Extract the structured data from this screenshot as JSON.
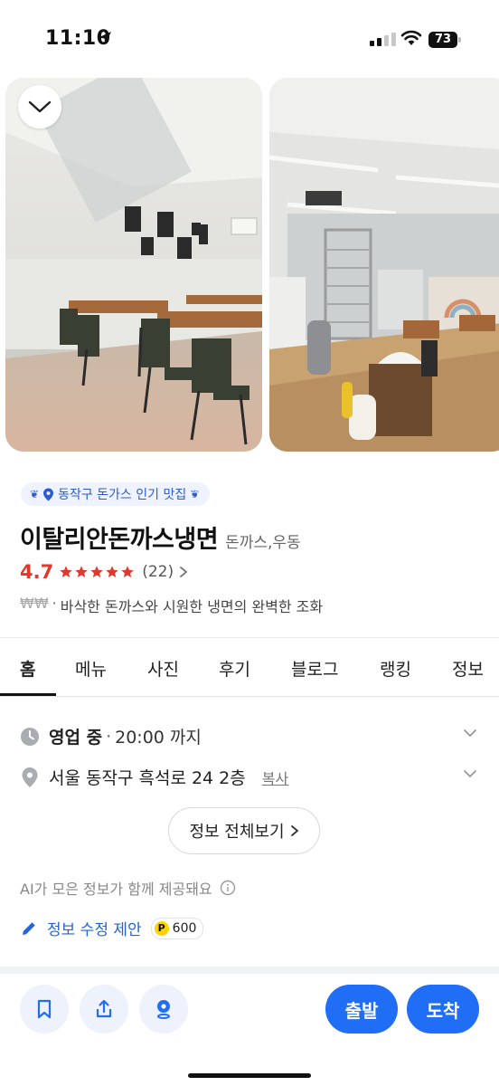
{
  "status_bar": {
    "time": "11:10",
    "battery": "73"
  },
  "place": {
    "badge": "동작구 돈가스 인기 맛집",
    "name": "이탈리안돈까스냉면",
    "category": "돈까스,우동",
    "rating": "4.7",
    "stars_filled": 5,
    "review_count": "(22)",
    "price_level": "₩₩",
    "separator": "·",
    "description": "바삭한 돈까스와 시원한 냉면의 완벽한 조화"
  },
  "tabs": [
    {
      "label": "홈",
      "active": true
    },
    {
      "label": "메뉴"
    },
    {
      "label": "사진"
    },
    {
      "label": "후기"
    },
    {
      "label": "블로그"
    },
    {
      "label": "랭킹"
    },
    {
      "label": "정보"
    }
  ],
  "hours": {
    "status": "영업 중",
    "separator": "·",
    "close_time": "20:00 까지"
  },
  "address": {
    "text": "서울 동작구 흑석로 24 2층",
    "copy_label": "복사"
  },
  "full_info_button": "정보 전체보기",
  "ai_note": "AI가 모은 정보가 함께 제공돼요",
  "edit": {
    "label": "정보 수정 제안",
    "points": "600",
    "coin": "P"
  },
  "bottom": {
    "depart_label": "출발",
    "arrive_label": "도착"
  },
  "colors": {
    "accent": "#1f6ef5",
    "rating": "#e2382b",
    "badge_bg": "#eef3ff"
  },
  "icons": [
    "location-arrow-icon",
    "chevron-down-icon",
    "pin-icon",
    "star-icon",
    "clock-icon",
    "info-icon",
    "pencil-icon",
    "bookmark-icon",
    "share-icon",
    "map-pin-icon"
  ]
}
